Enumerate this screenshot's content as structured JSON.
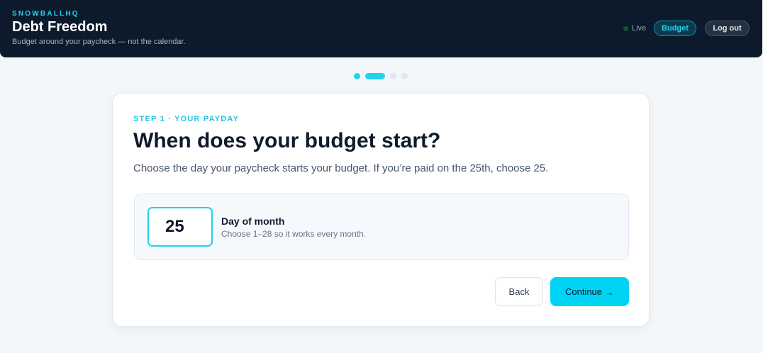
{
  "header": {
    "brand": "SNOWBALLHQ",
    "title": "Debt Freedom",
    "tagline": "Budget around your paycheck — not the calendar.",
    "status_label": "Live",
    "budget_label": "Budget",
    "logout_label": "Log out"
  },
  "progress": {
    "total_steps": 4,
    "current_step": 2,
    "steps": [
      {
        "state": "complete",
        "color": "#22d3ee"
      },
      {
        "state": "current",
        "color": "#22d3ee"
      },
      {
        "state": "upcoming",
        "color": "#e2e8f0"
      },
      {
        "state": "upcoming",
        "color": "#e2e8f0"
      }
    ]
  },
  "card": {
    "step_label": "STEP 1 · YOUR PAYDAY",
    "question": "When does your budget start?",
    "description": "Choose the day your paycheck starts your budget. If you’re paid on the 25th, choose 25.",
    "field": {
      "value": "25",
      "label": "Day of month",
      "hint": "Choose 1–28 so it works every month."
    },
    "back_label": "Back",
    "continue_label": "Continue",
    "continue_icon": "→"
  },
  "colors": {
    "accent": "#22d3ee",
    "header_bg": "#0c1a2b",
    "continue_bg": "#00d4f5",
    "live_dot": "#14532d"
  }
}
